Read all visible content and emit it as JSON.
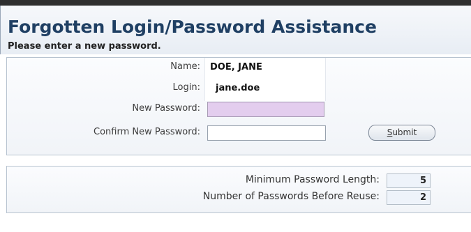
{
  "header": {
    "title": "Forgotten Login/Password Assistance",
    "subtitle": "Please enter a new password."
  },
  "form": {
    "name_label": "Name:",
    "name_value": "DOE, JANE",
    "login_label": "Login:",
    "login_value": "jane.doe",
    "new_password_label": "New Password:",
    "new_password_value": "",
    "confirm_password_label": "Confirm New Password:",
    "confirm_password_value": "",
    "submit_mnemonic": "S",
    "submit_rest": "ubmit"
  },
  "policy": {
    "min_length_label": "Minimum Password Length:",
    "min_length_value": "5",
    "reuse_label": "Number of Passwords Before Reuse:",
    "reuse_value": "2"
  }
}
